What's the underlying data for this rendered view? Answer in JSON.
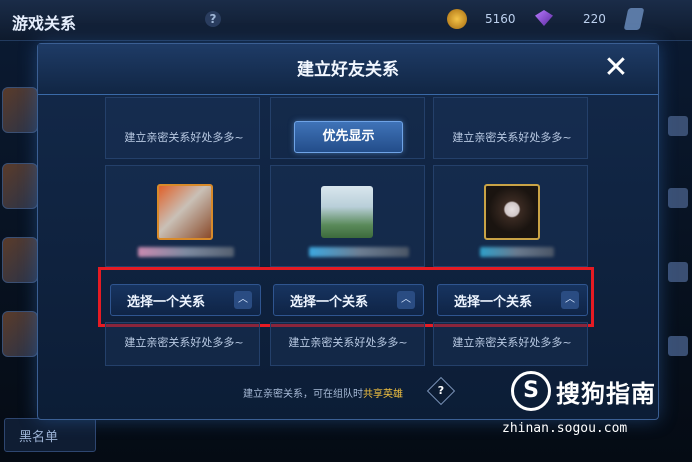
{
  "background": {
    "title": "游戏关系",
    "help": "?",
    "gold": "5160",
    "gems": "220",
    "blacklist": "黑名单"
  },
  "dialog": {
    "title": "建立好友关系",
    "close": "✕",
    "priority_button": "优先显示",
    "benefit_text": "建立亲密关系好处多多~",
    "select_label": "选择一个关系",
    "select_chevron": "︿",
    "footer_prefix": "建立亲密关系，可在组队时",
    "footer_highlight": "共享英雄",
    "footer_help": "?"
  },
  "watermark": {
    "logo": "S",
    "text": "搜狗指南",
    "url": "zhinan.sogou.com"
  },
  "colors": {
    "highlight_box": "#e51b23",
    "accent_gold": "#f0c040",
    "dialog_border": "#3b5f93"
  }
}
